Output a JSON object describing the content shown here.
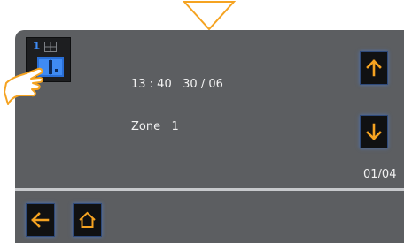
{
  "status": {
    "time": "13 : 40",
    "date": "30 / 06",
    "zone_label": "Zone",
    "zone_value": "1"
  },
  "lock_tile": {
    "zone_number": "1",
    "icon": "door-lock-icon"
  },
  "pagination": {
    "label": "01/04"
  },
  "icons": {
    "top_pointer": "down-triangle-icon",
    "scroll_up": "arrow-up-icon",
    "scroll_down": "arrow-down-icon",
    "back": "arrow-left-icon",
    "home": "home-icon",
    "touch": "pointing-hand-icon"
  },
  "colors": {
    "accent_orange": "#f5a321",
    "panel_bg": "#5c5e61",
    "button_bg": "#101112",
    "tile_blue": "#3f8bf3",
    "text": "#f2f2f2"
  }
}
